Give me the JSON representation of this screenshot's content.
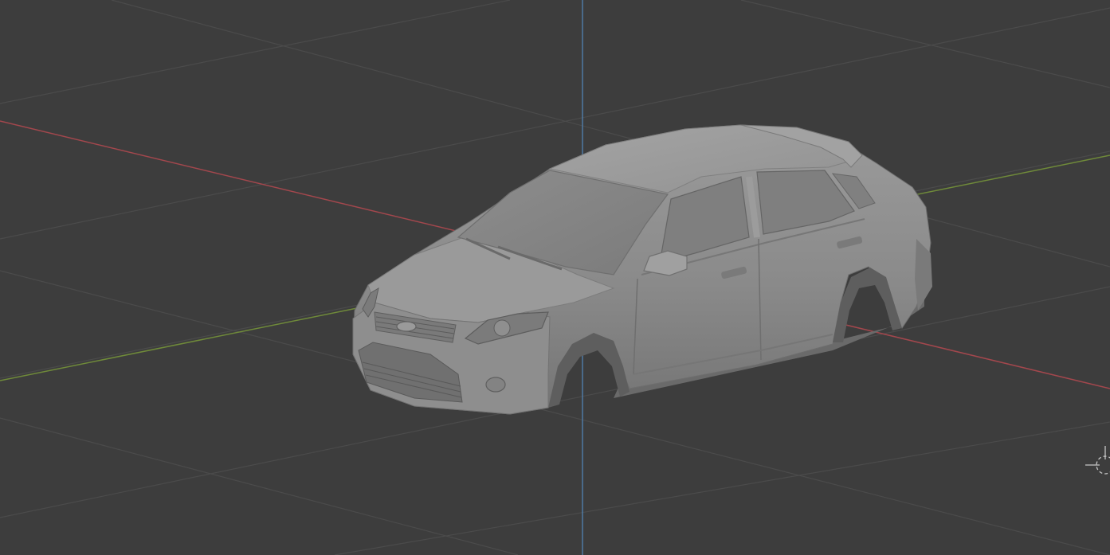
{
  "viewport": {
    "mode": "3d-viewport",
    "shading": "solid",
    "colors": {
      "background": "#3d3d3d",
      "grid": "#4b4b4b",
      "x_axis": "#a3474d",
      "y_axis": "#6f8a3a",
      "z_axis": "#4f7aa3",
      "model_base": "#8c8c8c",
      "cursor": "#c7c7c7"
    },
    "object": {
      "kind": "mesh",
      "icon": "car-body-mesh",
      "wheels_present": false
    },
    "overlays": {
      "floor_grid": true,
      "axes_shown": [
        "x",
        "y",
        "z"
      ],
      "cursor_icon": "3d-cursor-icon"
    }
  }
}
